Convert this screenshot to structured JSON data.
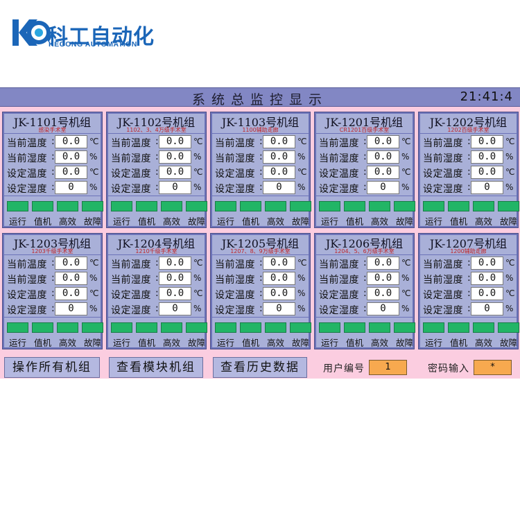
{
  "brand": {
    "name_cn": "科工自动化",
    "name_en": "KEGONG AUTOMATION",
    "color": "#1b66b8"
  },
  "header": {
    "title": "系统总监控显示",
    "clock": "21:41:4"
  },
  "row_labels": {
    "current_temp": "当前温度",
    "current_humidity": "当前湿度",
    "set_temp": "设定温度",
    "set_humidity": "设定湿度"
  },
  "units": {
    "temp": "℃",
    "humidity": "%"
  },
  "status_labels": [
    "运行",
    "值机",
    "高效",
    "故障"
  ],
  "status_color": "#22b566",
  "units_list": [
    {
      "name": "JK-1101号机组",
      "sub": "感染手术室",
      "current_temp": "0.0",
      "current_humidity": "0.0",
      "set_temp": "0.0",
      "set_humidity": "0",
      "set_temp_unit": "℃"
    },
    {
      "name": "JK-1102号机组",
      "sub": "1102、3、4万级手术室",
      "current_temp": "0.0",
      "current_humidity": "0.0",
      "set_temp": "0.0",
      "set_humidity": "0",
      "set_temp_unit": "℃"
    },
    {
      "name": "JK-1103号机组",
      "sub": "1100辅助走廊",
      "current_temp": "0.0",
      "current_humidity": "0.0",
      "set_temp": "0.0",
      "set_humidity": "0",
      "set_temp_unit": "℃"
    },
    {
      "name": "JK-1201号机组",
      "sub": "CR1201百级手术室",
      "current_temp": "0.0",
      "current_humidity": "0.0",
      "set_temp": "0.0",
      "set_humidity": "0",
      "set_temp_unit": "℃"
    },
    {
      "name": "JK-1202号机组",
      "sub": "1202百级手术室",
      "current_temp": "0.0",
      "current_humidity": "0.0",
      "set_temp": "0.0",
      "set_humidity": "0",
      "set_temp_unit": "℃"
    },
    {
      "name": "JK-1203号机组",
      "sub": "1203千级手术室",
      "current_temp": "0.0",
      "current_humidity": "0.0",
      "set_temp": "0.0",
      "set_humidity": "0",
      "set_temp_unit": "℃"
    },
    {
      "name": "JK-1204号机组",
      "sub": "1210千级手术室",
      "current_temp": "0.0",
      "current_humidity": "0.0",
      "set_temp": "0.0",
      "set_humidity": "0",
      "set_temp_unit": "℃"
    },
    {
      "name": "JK-1205号机组",
      "sub": "1207、8、9万级手术室",
      "current_temp": "0.0",
      "current_humidity": "0.0",
      "set_temp": "0.0",
      "set_humidity": "0",
      "set_temp_unit": "%"
    },
    {
      "name": "JK-1206号机组",
      "sub": "1204、5、6万级手术室",
      "current_temp": "0.0",
      "current_humidity": "0.0",
      "set_temp": "0.0",
      "set_humidity": "0",
      "set_temp_unit": "℃"
    },
    {
      "name": "JK-1207号机组",
      "sub": "1200辅助走廊",
      "current_temp": "0.0",
      "current_humidity": "0.0",
      "set_temp": "0.0",
      "set_humidity": "0",
      "set_temp_unit": "℃"
    }
  ],
  "footer": {
    "btn_operate": "操作所有机组",
    "btn_modules": "查看模块机组",
    "btn_history": "查看历史数据",
    "user_label": "用户编号",
    "user_value": "1",
    "password_label": "密码输入",
    "password_value": "*"
  }
}
